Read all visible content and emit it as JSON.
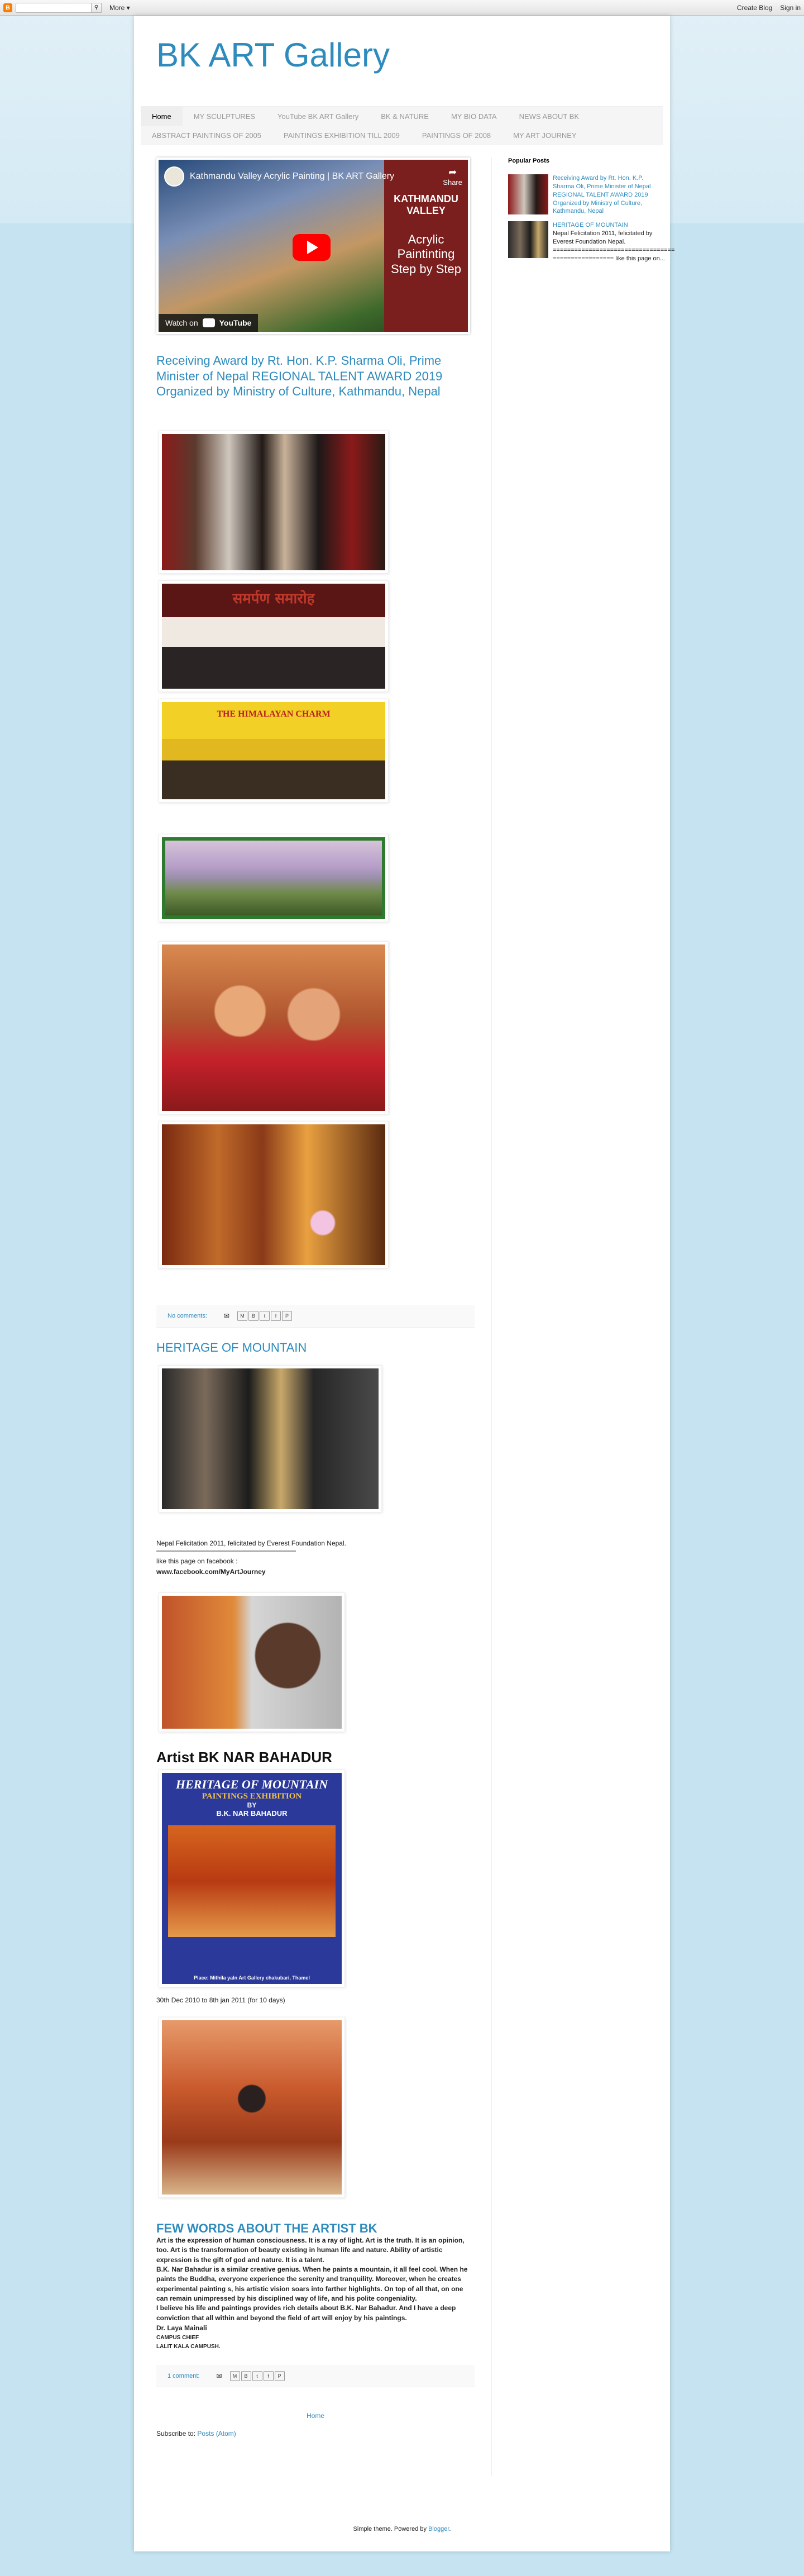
{
  "navbar": {
    "more_label": "More ▾",
    "create_blog": "Create Blog",
    "sign_in": "Sign in"
  },
  "blog": {
    "title": "BK ART Gallery"
  },
  "tabs": {
    "row1": [
      "Home",
      "MY SCULPTURES",
      "YouTube BK ART Gallery",
      "BK & NATURE",
      "MY BIO DATA",
      "NEWS ABOUT BK"
    ],
    "row2": [
      "ABSTRACT PAINTINGS OF 2005",
      "PAINTINGS EXHIBITION TILL 2009",
      "PAINTINGS OF 2008",
      "MY ART JOURNEY"
    ]
  },
  "video": {
    "title": "Kathmandu Valley Acrylic Painting | BK ART Gallery",
    "share": "Share",
    "label_top": "KATHMANDU VALLEY",
    "label_bottom": "Acrylic Paintinting Step by Step",
    "watch_on": "Watch on",
    "youtube": "YouTube"
  },
  "post1": {
    "title": "Receiving Award by Rt. Hon. K.P. Sharma Oli, Prime Minister of Nepal REGIONAL TALENT AWARD 2019 Organized by Ministry of Culture, Kathmandu, Nepal",
    "banner_text_2": "समर्पण समारोह",
    "banner_text_3": "THE HIMALAYAN CHARM",
    "comments": "No comments:"
  },
  "post2": {
    "title": "HERITAGE OF MOUNTAIN",
    "caption": "Nepal Felicitation 2011, felicitated by Everest Foundation Nepal.",
    "like_text": "like this page on facebook :",
    "fb_link": "www.facebook.com/MyArtJourney",
    "artist_heading": "Artist BK NAR BAHADUR",
    "poster_title": "HERITAGE OF MOUNTAIN",
    "poster_sub": "PAINTINGS EXHIBITION",
    "poster_by": "BY",
    "poster_name": "B.K. NAR BAHADUR",
    "poster_place": "Place: Mithila yaln Art Gallery chakubari, Thamel",
    "dates": "30th Dec 2010 to 8th jan 2011 (for 10 days)",
    "few_words_title": "FEW WORDS ABOUT THE ARTIST BK",
    "paragraph": "Art is the expression of human consciousness. It is a ray of light. Art is the truth. It is an opinion, too. Art is the transformation of beauty existing in human life and nature. Ability of artistic expression is the gift of god and nature. It is a talent.\nB.K. Nar Bahadur is a similar creative genius. When he paints a mountain, it all feel cool. When he paints the Buddha, everyone experience the serenity and tranquility. Moreover, when he creates experimental painting s, his artistic vision soars into farther highlights. On top of all that, on one can remain unimpressed by his disciplined way of life, and his polite congeniality.\nI believe his life and paintings provides rich details about B.K. Nar Bahadur. And I have a deep conviction that all within and beyond the field of art will enjoy by his paintings.",
    "signer": "Dr. Laya Mainali",
    "signer_title1": "CAMPUS CHIEF",
    "signer_title2": "LALIT KALA CAMPUSH.",
    "comments": "1 comment:"
  },
  "share": [
    "M",
    "B",
    "t",
    "f",
    "P"
  ],
  "bottom": {
    "home": "Home",
    "subscribe_prefix": "Subscribe to:",
    "subscribe_link": "Posts (Atom)",
    "footer_prefix": "Simple theme. Powered by",
    "footer_link": "Blogger",
    "footer_suffix": "."
  },
  "sidebar": {
    "title": "Popular Posts",
    "item1": "Receiving Award by Rt. Hon. K.P. Sharma Oli, Prime Minister of Nepal REGIONAL TALENT AWARD 2019 Organized by Ministry of Culture, Kathmandu, Nepal",
    "item2_title": "HERITAGE OF MOUNTAIN",
    "item2_snippet": "Nepal Felicitation 2011, felicitated by Everest Foundation Nepal. ================================== ================= like this page on..."
  },
  "colors": {
    "accent": "#2d8bbd",
    "background": "#c5e3f1"
  }
}
